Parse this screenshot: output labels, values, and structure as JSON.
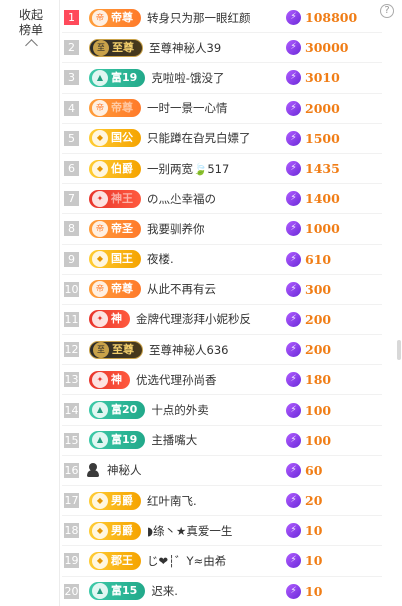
{
  "panel": {
    "collapse_label": "收起榜单"
  },
  "help": {
    "icon": "?"
  },
  "rows": [
    {
      "rank": "1",
      "badge": {
        "label": "帝尊",
        "style": "orange",
        "emblem": "帝",
        "faded": false
      },
      "nick": "转身只为那一眼红颜",
      "value": "108800"
    },
    {
      "rank": "2",
      "badge": {
        "label": "至尊",
        "style": "black",
        "emblem": "至",
        "faded": false
      },
      "nick": "至尊神秘人39",
      "value": "30000"
    },
    {
      "rank": "3",
      "badge": {
        "label": "富19",
        "style": "teal",
        "emblem": "▲",
        "faded": false
      },
      "nick": "克啦啦-饿没了",
      "value": "3010"
    },
    {
      "rank": "4",
      "badge": {
        "label": "帝尊",
        "style": "orange",
        "emblem": "帝",
        "faded": true
      },
      "nick": "一时一景一心情",
      "value": "2000"
    },
    {
      "rank": "5",
      "badge": {
        "label": "国公",
        "style": "gold",
        "emblem": "◆",
        "faded": false
      },
      "nick": "只能蹲在旮旯白嫖了",
      "value": "1500"
    },
    {
      "rank": "6",
      "badge": {
        "label": "伯爵",
        "style": "gold",
        "emblem": "◆",
        "faded": false
      },
      "nick": "一别两宽🍃517",
      "value": "1435"
    },
    {
      "rank": "7",
      "badge": {
        "label": "神王",
        "style": "red",
        "emblem": "✦",
        "faded": true
      },
      "nick": "の灬尐幸福の",
      "value": "1400"
    },
    {
      "rank": "8",
      "badge": {
        "label": "帝圣",
        "style": "orange",
        "emblem": "帝",
        "faded": false
      },
      "nick": "我要驯养你",
      "value": "1000"
    },
    {
      "rank": "9",
      "badge": {
        "label": "国王",
        "style": "gold",
        "emblem": "◆",
        "faded": false
      },
      "nick": "夜楼.",
      "value": "610"
    },
    {
      "rank": "10",
      "badge": {
        "label": "帝尊",
        "style": "orange",
        "emblem": "帝",
        "faded": false
      },
      "nick": "从此不再有云",
      "value": "300"
    },
    {
      "rank": "11",
      "badge": {
        "label": "神",
        "style": "red",
        "emblem": "✦",
        "faded": false
      },
      "nick": "金牌代理澎拜小妮秒反",
      "value": "200"
    },
    {
      "rank": "12",
      "badge": {
        "label": "至尊",
        "style": "black",
        "emblem": "至",
        "faded": false
      },
      "nick": "至尊神秘人636",
      "value": "200"
    },
    {
      "rank": "13",
      "badge": {
        "label": "神",
        "style": "red",
        "emblem": "✦",
        "faded": false
      },
      "nick": "优选代理孙尚香",
      "value": "180"
    },
    {
      "rank": "14",
      "badge": {
        "label": "富20",
        "style": "teal",
        "emblem": "▲",
        "faded": false
      },
      "nick": "十点的外卖",
      "value": "100"
    },
    {
      "rank": "15",
      "badge": {
        "label": "富19",
        "style": "teal",
        "emblem": "▲",
        "faded": false
      },
      "nick": "主播嘴大",
      "value": "100"
    },
    {
      "rank": "16",
      "badge": null,
      "nick": "神秘人",
      "value": "60"
    },
    {
      "rank": "17",
      "badge": {
        "label": "男爵",
        "style": "gold",
        "emblem": "◆",
        "faded": false
      },
      "nick": "红叶南飞.",
      "value": "20"
    },
    {
      "rank": "18",
      "badge": {
        "label": "男爵",
        "style": "gold",
        "emblem": "◆",
        "faded": false
      },
      "nick": "◗绦丶★真爱一生",
      "value": "10"
    },
    {
      "rank": "19",
      "badge": {
        "label": "郡王",
        "style": "gold",
        "emblem": "◆",
        "faded": false
      },
      "nick": "じ❤┆゛Y≈由希",
      "value": "10"
    },
    {
      "rank": "20",
      "badge": {
        "label": "富15",
        "style": "teal",
        "emblem": "▲",
        "faded": false
      },
      "nick": "迟来.",
      "value": "10"
    }
  ]
}
